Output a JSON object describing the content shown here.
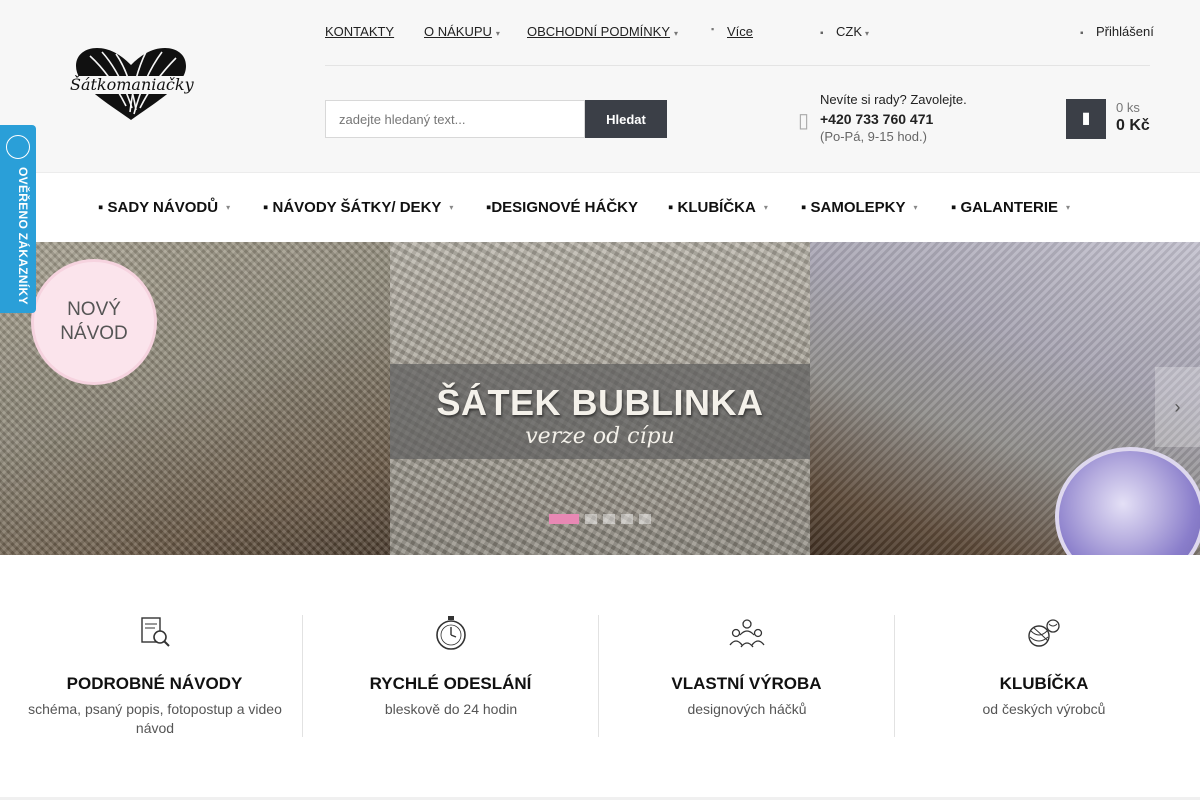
{
  "brand": {
    "logo_text": "Šátkomaniačky"
  },
  "topnav": {
    "items": [
      {
        "label": "KONTAKTY",
        "has_dropdown": false
      },
      {
        "label": "O NÁKUPU",
        "has_dropdown": true
      },
      {
        "label": "OBCHODNÍ PODMÍNKY",
        "has_dropdown": true
      },
      {
        "label": "Více",
        "has_dropdown": false
      }
    ],
    "currency": "CZK",
    "login": "Přihlášení"
  },
  "search": {
    "placeholder": "zadejte hledaný text...",
    "button": "Hledat"
  },
  "contact": {
    "prompt": "Nevíte si rady? Zavolejte.",
    "phone": "+420 733 760 471",
    "hours": "(Po-Pá, 9-15 hod.)"
  },
  "cart": {
    "qty": "0 ks",
    "total": "0 Kč"
  },
  "mainnav": {
    "items": [
      {
        "label": "▪ SADY NÁVODŮ",
        "has_dropdown": true
      },
      {
        "label": "▪ NÁVODY ŠÁTKY/ DEKY",
        "has_dropdown": true
      },
      {
        "label": "▪DESIGNOVÉ HÁČKY",
        "has_dropdown": false
      },
      {
        "label": "▪ KLUBÍČKA",
        "has_dropdown": true
      },
      {
        "label": "▪ SAMOLEPKY",
        "has_dropdown": true
      },
      {
        "label": "▪ GALANTERIE",
        "has_dropdown": true
      }
    ]
  },
  "verified_badge": {
    "label": "OVĚŘENO ZÁKAZNÍKY"
  },
  "banner": {
    "badge_line1": "NOVÝ",
    "badge_line2": "NÁVOD",
    "title": "ŠÁTEK BUBLINKA",
    "subtitle": "verze od cípu",
    "slides": 5,
    "active_slide": 1
  },
  "features": [
    {
      "icon": "magnifier-document-icon",
      "title": "PODROBNÉ NÁVODY",
      "desc": "schéma, psaný popis, fotopostup a video návod"
    },
    {
      "icon": "stopwatch-icon",
      "title": "RYCHLÉ ODESLÁNÍ",
      "desc": "bleskově do 24 hodin"
    },
    {
      "icon": "people-group-icon",
      "title": "VLASTNÍ VÝROBA",
      "desc": "designových háčků"
    },
    {
      "icon": "yarn-balls-icon",
      "title": "KLUBÍČKA",
      "desc": "od českých výrobců"
    }
  ],
  "colors": {
    "dark_button": "#3b3f47",
    "accent_pink": "#e888b4",
    "verified_blue": "#2a9fd8"
  }
}
